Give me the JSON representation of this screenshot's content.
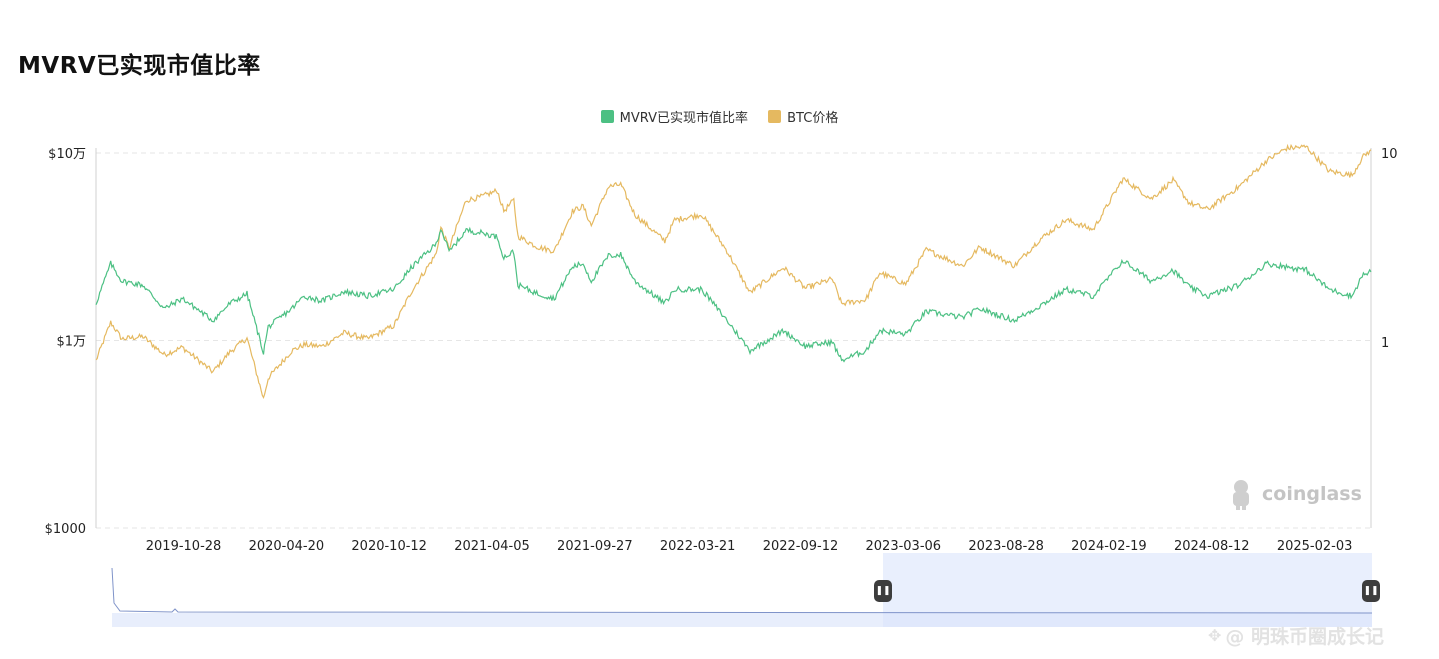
{
  "page": {
    "title": "MVRV已实现市值比率",
    "watermark": "coinglass",
    "footer_mark": "@ 明珠币圈成长记"
  },
  "colors": {
    "mvrv": "#4cc083",
    "btc": "#e5b960",
    "grid": "#e6e6e6",
    "axis": "#d0d0d0",
    "slider_fill": "#dbe4fb",
    "slider_line": "#7f93c9"
  },
  "chart_data": {
    "type": "line",
    "legend_position": "top-center",
    "grid": true,
    "series": [
      {
        "name": "MVRV已实现市值比率",
        "axis": "right",
        "color": "#4cc083"
      },
      {
        "name": "BTC价格",
        "axis": "left",
        "color": "#e5b960"
      }
    ],
    "x_ticks": [
      "2019-10-28",
      "2020-04-20",
      "2020-10-12",
      "2021-04-05",
      "2021-09-27",
      "2022-03-21",
      "2022-09-12",
      "2023-03-06",
      "2023-08-28",
      "2024-02-19",
      "2024-08-12",
      "2025-02-03"
    ],
    "y_left": {
      "scale": "log",
      "ticks": [
        "$1000",
        "$1万",
        "$10万"
      ],
      "tick_values": [
        1000,
        10000,
        100000
      ]
    },
    "y_right": {
      "scale": "log",
      "ticks": [
        "1",
        "10"
      ],
      "tick_values": [
        1,
        10
      ]
    },
    "x_range": [
      "2019-06-01",
      "2025-05-10"
    ],
    "btc_points": [
      [
        "2019-06-01",
        7800
      ],
      [
        "2019-06-26",
        12500
      ],
      [
        "2019-07-15",
        10200
      ],
      [
        "2019-08-20",
        10500
      ],
      [
        "2019-09-25",
        8400
      ],
      [
        "2019-10-26",
        9200
      ],
      [
        "2019-12-17",
        6800
      ],
      [
        "2020-01-15",
        8700
      ],
      [
        "2020-02-13",
        10300
      ],
      [
        "2020-03-12",
        4900
      ],
      [
        "2020-03-20",
        6300
      ],
      [
        "2020-04-29",
        8800
      ],
      [
        "2020-05-20",
        9500
      ],
      [
        "2020-06-20",
        9300
      ],
      [
        "2020-07-27",
        11000
      ],
      [
        "2020-09-05",
        10200
      ],
      [
        "2020-10-20",
        12000
      ],
      [
        "2020-11-20",
        18500
      ],
      [
        "2020-12-31",
        29000
      ],
      [
        "2021-01-08",
        40000
      ],
      [
        "2021-01-22",
        31000
      ],
      [
        "2021-02-20",
        56000
      ],
      [
        "2021-03-15",
        58000
      ],
      [
        "2021-04-14",
        63000
      ],
      [
        "2021-04-25",
        49000
      ],
      [
        "2021-05-12",
        56000
      ],
      [
        "2021-05-19",
        36000
      ],
      [
        "2021-06-22",
        31500
      ],
      [
        "2021-07-20",
        30000
      ],
      [
        "2021-08-20",
        49000
      ],
      [
        "2021-09-07",
        52000
      ],
      [
        "2021-09-21",
        41000
      ],
      [
        "2021-10-20",
        66000
      ],
      [
        "2021-11-10",
        68000
      ],
      [
        "2021-12-04",
        47000
      ],
      [
        "2022-01-24",
        34000
      ],
      [
        "2022-02-10",
        44000
      ],
      [
        "2022-03-28",
        47000
      ],
      [
        "2022-05-10",
        30000
      ],
      [
        "2022-06-18",
        18000
      ],
      [
        "2022-08-14",
        24500
      ],
      [
        "2022-09-20",
        19000
      ],
      [
        "2022-11-05",
        21300
      ],
      [
        "2022-11-21",
        15700
      ],
      [
        "2023-01-01",
        16500
      ],
      [
        "2023-01-25",
        23000
      ],
      [
        "2023-03-10",
        20000
      ],
      [
        "2023-04-14",
        30500
      ],
      [
        "2023-06-15",
        25000
      ],
      [
        "2023-07-14",
        31500
      ],
      [
        "2023-09-11",
        25000
      ],
      [
        "2023-10-24",
        34500
      ],
      [
        "2023-12-08",
        44000
      ],
      [
        "2024-01-23",
        39000
      ],
      [
        "2024-03-14",
        73000
      ],
      [
        "2024-05-01",
        57000
      ],
      [
        "2024-06-07",
        71500
      ],
      [
        "2024-07-05",
        54000
      ],
      [
        "2024-08-05",
        50000
      ],
      [
        "2024-09-27",
        66000
      ],
      [
        "2024-11-13",
        91000
      ],
      [
        "2024-12-17",
        106000
      ],
      [
        "2025-01-20",
        108000
      ],
      [
        "2025-02-28",
        80000
      ],
      [
        "2025-04-08",
        76000
      ],
      [
        "2025-04-25",
        94500
      ],
      [
        "2025-05-10",
        104000
      ]
    ],
    "mvrv_points": [
      [
        "2019-06-01",
        1.6
      ],
      [
        "2019-06-26",
        2.6
      ],
      [
        "2019-07-15",
        2.1
      ],
      [
        "2019-08-20",
        2.0
      ],
      [
        "2019-09-25",
        1.5
      ],
      [
        "2019-10-26",
        1.7
      ],
      [
        "2019-12-17",
        1.3
      ],
      [
        "2020-01-15",
        1.6
      ],
      [
        "2020-02-13",
        1.8
      ],
      [
        "2020-03-12",
        0.88
      ],
      [
        "2020-03-20",
        1.2
      ],
      [
        "2020-04-29",
        1.5
      ],
      [
        "2020-05-20",
        1.75
      ],
      [
        "2020-06-20",
        1.65
      ],
      [
        "2020-07-27",
        1.85
      ],
      [
        "2020-09-05",
        1.75
      ],
      [
        "2020-10-20",
        1.9
      ],
      [
        "2020-11-20",
        2.5
      ],
      [
        "2020-12-31",
        3.3
      ],
      [
        "2021-01-08",
        4.0
      ],
      [
        "2021-01-22",
        3.0
      ],
      [
        "2021-02-20",
        3.9
      ],
      [
        "2021-03-15",
        3.8
      ],
      [
        "2021-04-14",
        3.6
      ],
      [
        "2021-04-25",
        2.8
      ],
      [
        "2021-05-12",
        3.0
      ],
      [
        "2021-05-19",
        2.0
      ],
      [
        "2021-06-22",
        1.8
      ],
      [
        "2021-07-20",
        1.7
      ],
      [
        "2021-08-20",
        2.5
      ],
      [
        "2021-09-07",
        2.6
      ],
      [
        "2021-09-21",
        2.1
      ],
      [
        "2021-10-20",
        2.85
      ],
      [
        "2021-11-10",
        2.9
      ],
      [
        "2021-12-04",
        2.1
      ],
      [
        "2022-01-24",
        1.6
      ],
      [
        "2022-02-10",
        1.9
      ],
      [
        "2022-03-28",
        1.9
      ],
      [
        "2022-05-10",
        1.3
      ],
      [
        "2022-06-18",
        0.9
      ],
      [
        "2022-08-14",
        1.15
      ],
      [
        "2022-09-20",
        0.95
      ],
      [
        "2022-11-05",
        1.0
      ],
      [
        "2022-11-21",
        0.8
      ],
      [
        "2023-01-01",
        0.9
      ],
      [
        "2023-01-25",
        1.15
      ],
      [
        "2023-03-10",
        1.1
      ],
      [
        "2023-04-14",
        1.45
      ],
      [
        "2023-06-15",
        1.35
      ],
      [
        "2023-07-14",
        1.5
      ],
      [
        "2023-09-11",
        1.3
      ],
      [
        "2023-10-24",
        1.55
      ],
      [
        "2023-12-08",
        1.9
      ],
      [
        "2024-01-23",
        1.75
      ],
      [
        "2024-03-14",
        2.7
      ],
      [
        "2024-05-01",
        2.1
      ],
      [
        "2024-06-07",
        2.4
      ],
      [
        "2024-07-05",
        1.95
      ],
      [
        "2024-08-05",
        1.75
      ],
      [
        "2024-09-27",
        2.0
      ],
      [
        "2024-11-13",
        2.6
      ],
      [
        "2024-12-17",
        2.5
      ],
      [
        "2025-01-20",
        2.4
      ],
      [
        "2025-02-28",
        1.9
      ],
      [
        "2025-04-08",
        1.75
      ],
      [
        "2025-04-25",
        2.25
      ],
      [
        "2025-05-10",
        2.35
      ]
    ]
  }
}
